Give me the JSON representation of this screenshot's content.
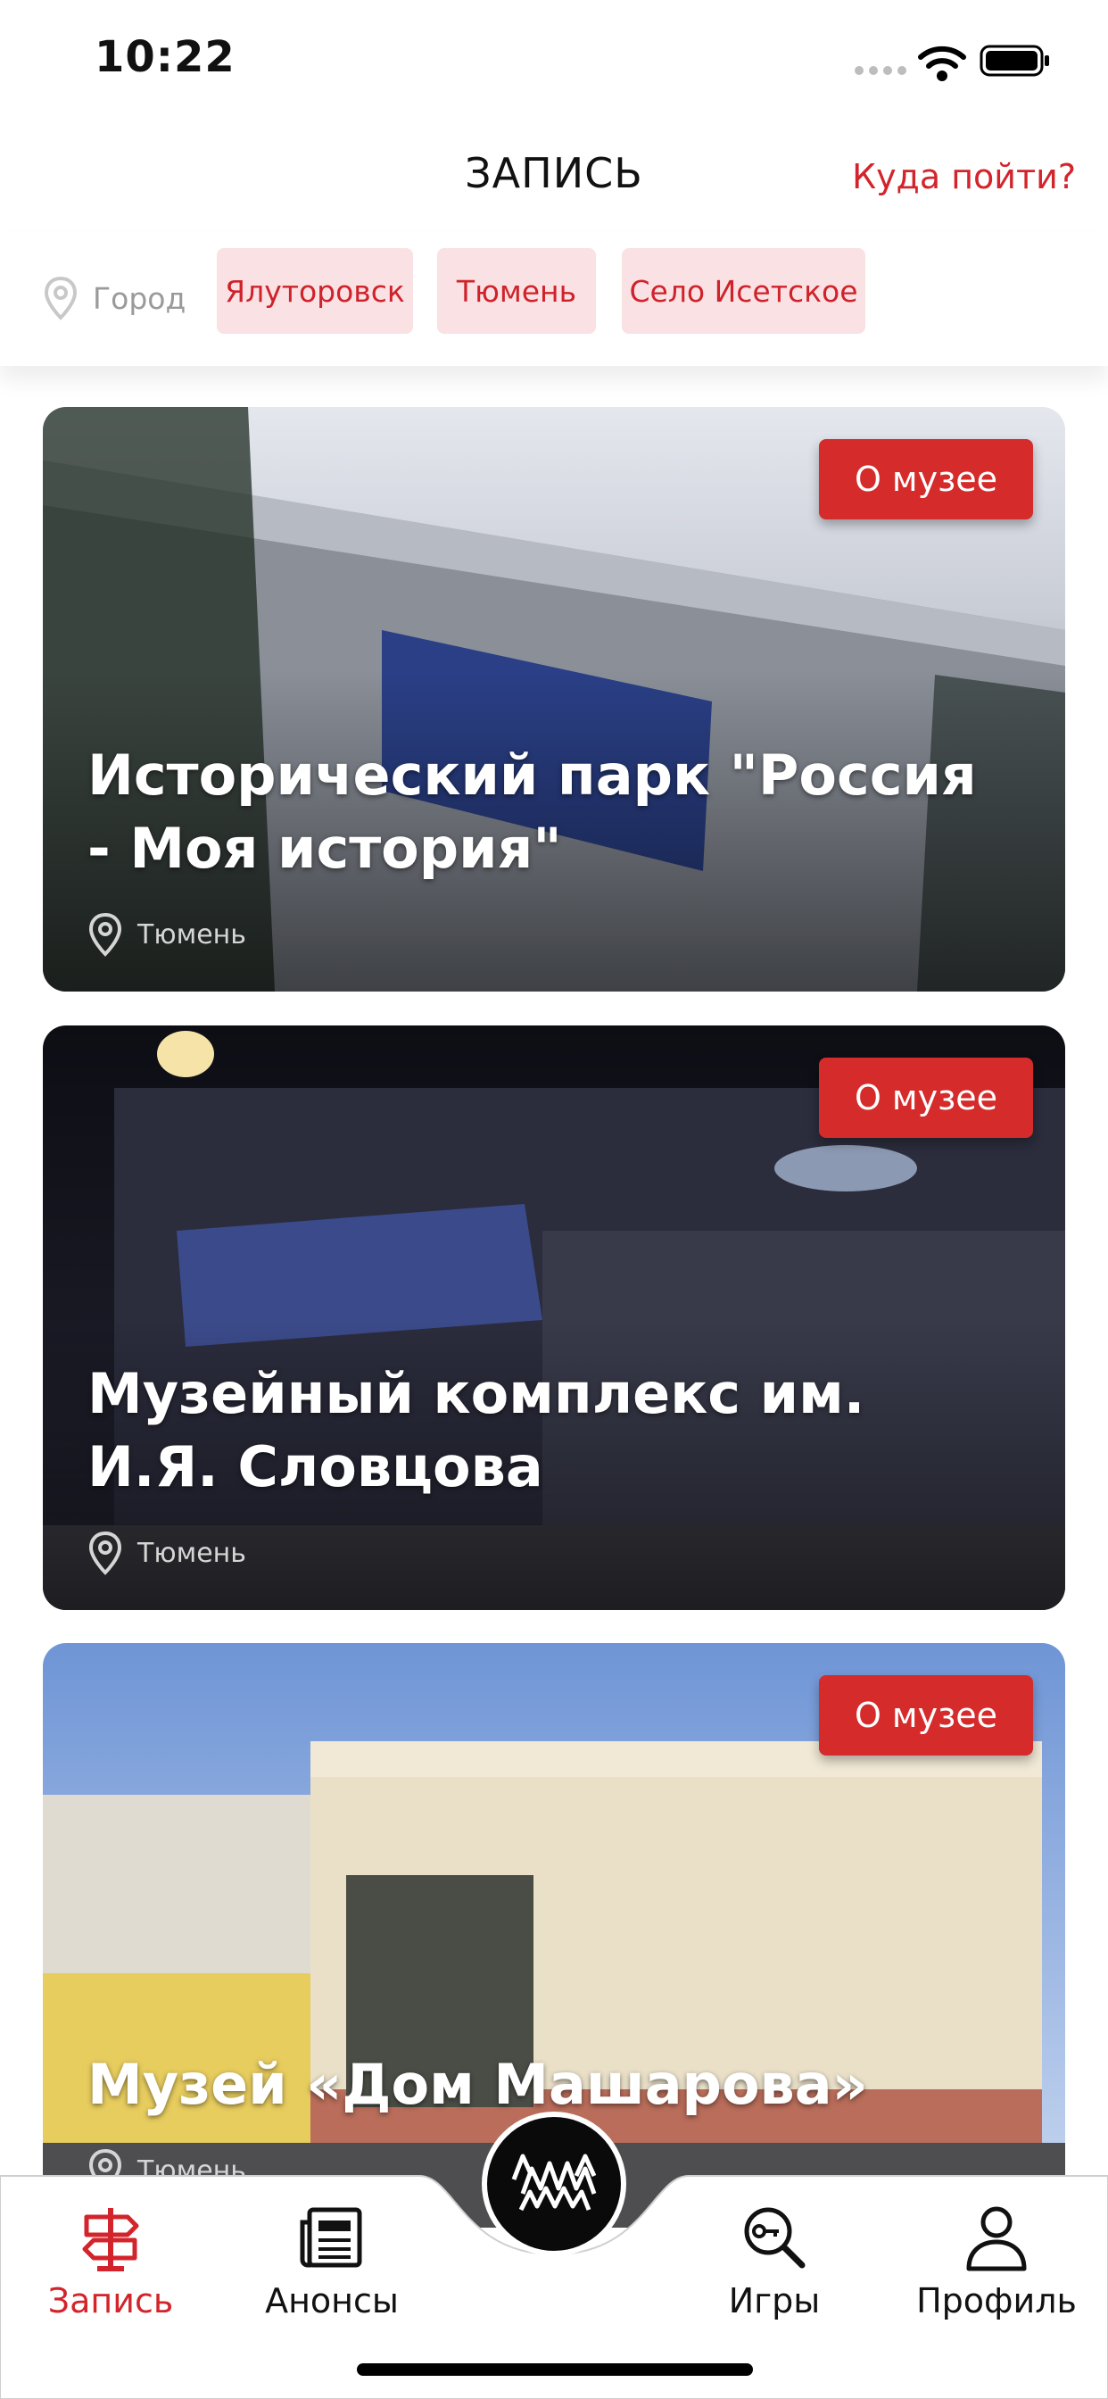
{
  "status_bar": {
    "time": "10:22"
  },
  "header": {
    "title": "ЗАПИСЬ",
    "where_link": "Куда пойти?"
  },
  "city_filter": {
    "label": "Город",
    "icon": "location-pin-icon",
    "options": [
      "Ялуторовск",
      "Тюмень",
      "Село Исетское"
    ]
  },
  "museums": [
    {
      "title": "Исторический парк \"Россия - Моя история\"",
      "city": "Тюмень",
      "button": "О музее"
    },
    {
      "title": "Музейный комплекс им. И.Я. Словцова",
      "city": "Тюмень",
      "button": "О музее"
    },
    {
      "title": "Музей «Дом Машарова»",
      "city": "Тюмень",
      "button": "О музее"
    }
  ],
  "tabs": [
    {
      "label": "Запись",
      "icon": "signpost-icon",
      "active": true
    },
    {
      "label": "Анонсы",
      "icon": "newspaper-icon",
      "active": false
    },
    {
      "label": "Игры",
      "icon": "key-search-icon",
      "active": false
    },
    {
      "label": "Профиль",
      "icon": "user-icon",
      "active": false
    }
  ],
  "colors": {
    "accent": "#d3242b",
    "chip_bg": "#fae1e3",
    "button_red": "#d52b2b"
  }
}
